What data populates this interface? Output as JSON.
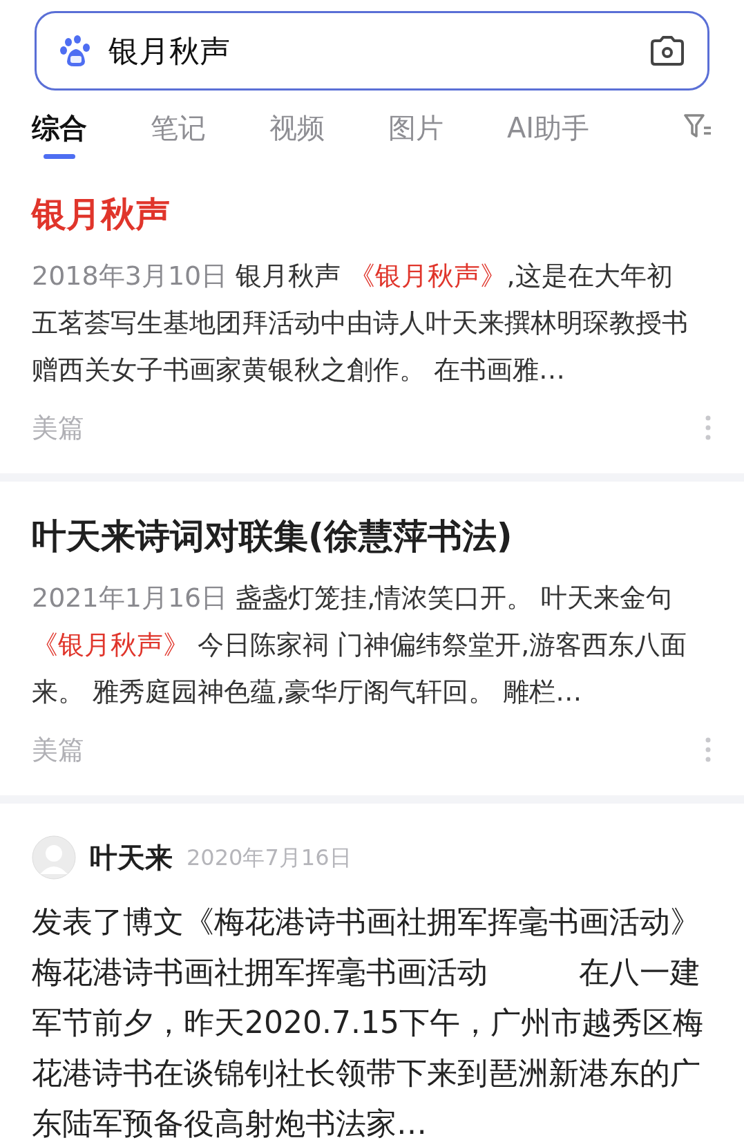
{
  "search": {
    "value": "银月秋声"
  },
  "tabs": [
    {
      "label": "综合",
      "selected": true
    },
    {
      "label": "笔记",
      "selected": false
    },
    {
      "label": "视频",
      "selected": false
    },
    {
      "label": "图片",
      "selected": false
    },
    {
      "label": "AI助手",
      "selected": false
    }
  ],
  "results": [
    {
      "kind": "article",
      "title": "银月秋声",
      "title_matched": true,
      "snippet": [
        {
          "kind": "date",
          "text": "2018年3月10日 "
        },
        {
          "kind": "plain",
          "text": "银月秋声 "
        },
        {
          "kind": "highlight",
          "text": "《银月秋声》"
        },
        {
          "kind": "plain",
          "text": ",这是在大年初五茗荟写生基地团拜活动中由诗人叶天来撰林明琛教授书赠西关女子书画家黄银秋之創作。 在书画雅…"
        }
      ],
      "source": "美篇"
    },
    {
      "kind": "article",
      "title": "叶天来诗词对联集(徐慧萍书法)",
      "title_matched": false,
      "snippet": [
        {
          "kind": "date",
          "text": "2021年1月16日 "
        },
        {
          "kind": "plain",
          "text": "盏盏灯笼挂,情浓笑口开。 叶天来金句"
        },
        {
          "kind": "highlight",
          "text": "《银月秋声》"
        },
        {
          "kind": "plain",
          "text": " 今日陈家祠 门神偏纬祭堂开,游客西东八面来。 雅秀庭园神色蕴,豪华厅阁气轩回。 雕栏…"
        }
      ],
      "source": "美篇"
    },
    {
      "kind": "post",
      "author": "叶天来",
      "date": "2020年7月16日",
      "body": "发表了博文《梅花港诗书画社拥军挥毫书画活动》梅花港诗书画社拥军挥毫书画活动　　　在八一建军节前夕，昨天2020.7.15下午，广州市越秀区梅花港诗书在谈锦钊社长领带下来到琶洲新港东的广东陆军预备役高射炮书法家…"
    }
  ]
}
